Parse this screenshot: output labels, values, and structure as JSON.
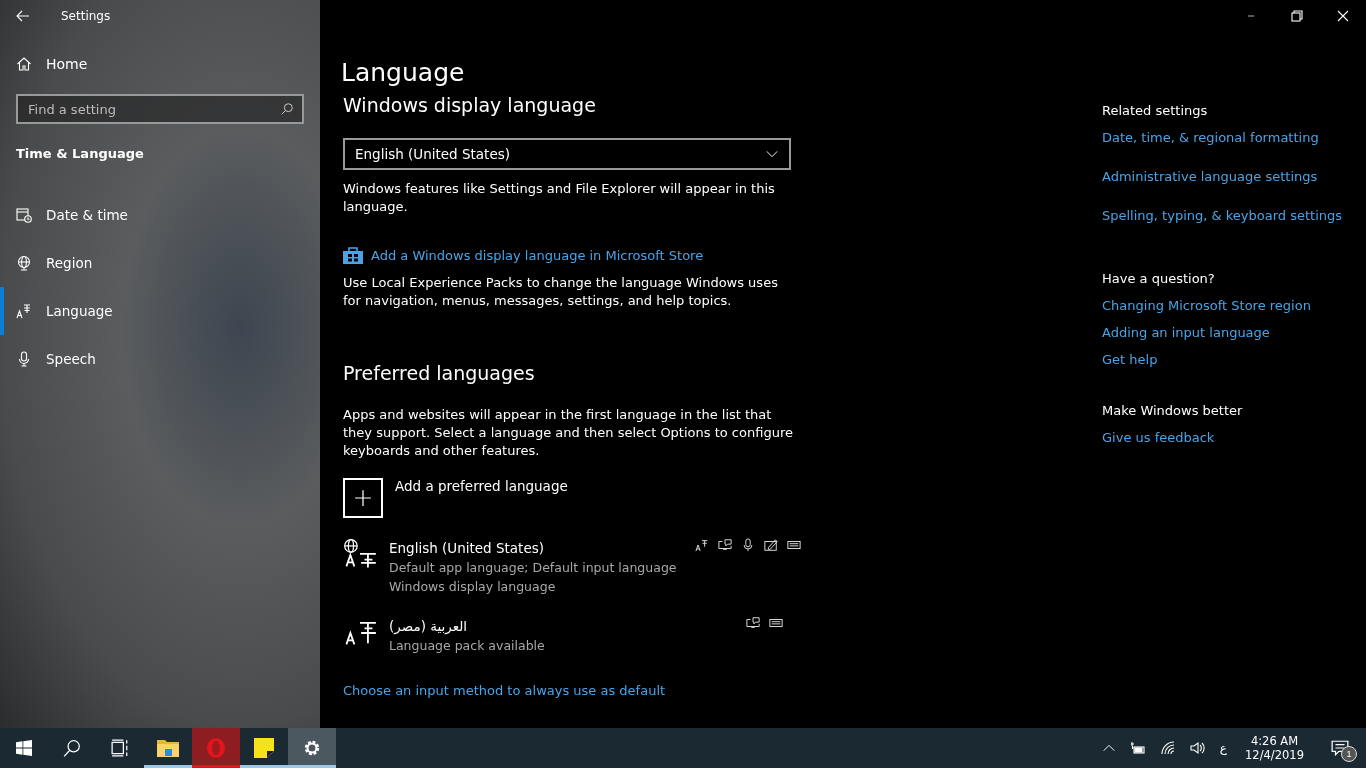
{
  "window": {
    "title": "Settings"
  },
  "sidebar": {
    "home": "Home",
    "search": {
      "placeholder": "Find a setting"
    },
    "section": "Time & Language",
    "items": [
      {
        "label": "Date & time",
        "kind": "calendar",
        "selected": false
      },
      {
        "label": "Region",
        "kind": "globe",
        "selected": false
      },
      {
        "label": "Language",
        "kind": "language",
        "selected": true
      },
      {
        "label": "Speech",
        "kind": "microphone",
        "selected": false
      }
    ]
  },
  "page": {
    "title": "Language",
    "display_language": {
      "heading": "Windows display language",
      "dropdown": "English (United States)",
      "description": "Windows features like Settings and File Explorer will appear in this language.",
      "store_link": "Add a Windows display language in Microsoft Store",
      "store_description": "Use Local Experience Packs to change the language Windows uses for navigation, menus, messages, settings, and help topics."
    },
    "preferred": {
      "heading": "Preferred languages",
      "description": "Apps and websites will appear in the first language in the list that they support. Select a language and then select Options to configure keyboards and other features.",
      "add_label": "Add a preferred language",
      "languages": [
        {
          "name": "English (United States)",
          "details": [
            "Default app language; Default input language",
            "Windows display language"
          ],
          "kind": "display",
          "features": [
            {
              "kind": "language-pack"
            },
            {
              "kind": "text-to-speech"
            },
            {
              "kind": "speech"
            },
            {
              "kind": "handwriting"
            },
            {
              "kind": "keyboard"
            }
          ]
        },
        {
          "name": "العربية (مصر)",
          "details": [
            "Language pack available"
          ],
          "kind": "installed",
          "features": [
            {
              "kind": "text-to-speech"
            },
            {
              "kind": "keyboard"
            }
          ]
        }
      ],
      "bottom_link": "Choose an input method to always use as default"
    }
  },
  "related": [
    {
      "heading": "Related settings",
      "links": [
        "Date, time, & regional formatting",
        "Administrative language settings",
        "Spelling, typing, & keyboard settings"
      ]
    },
    {
      "heading": "Have a question?",
      "links": [
        "Changing Microsoft Store region",
        "Adding an input language",
        "Get help"
      ]
    },
    {
      "heading": "Make Windows better",
      "links": [
        "Give us feedback"
      ]
    }
  ],
  "taskbar": {
    "apps": [
      {
        "kind": "start",
        "running": false,
        "selected": false
      },
      {
        "kind": "search",
        "running": false,
        "selected": false
      },
      {
        "kind": "task-view",
        "running": false,
        "selected": false
      },
      {
        "kind": "folder",
        "running": true,
        "selected": false
      },
      {
        "kind": "browser",
        "running": true,
        "selected": false
      },
      {
        "kind": "notes",
        "running": true,
        "selected": false
      },
      {
        "kind": "gear",
        "running": true,
        "selected": true
      }
    ],
    "input_indicator": "ع",
    "time": "4:26 AM",
    "date": "12/4/2019",
    "notifications": "1"
  }
}
